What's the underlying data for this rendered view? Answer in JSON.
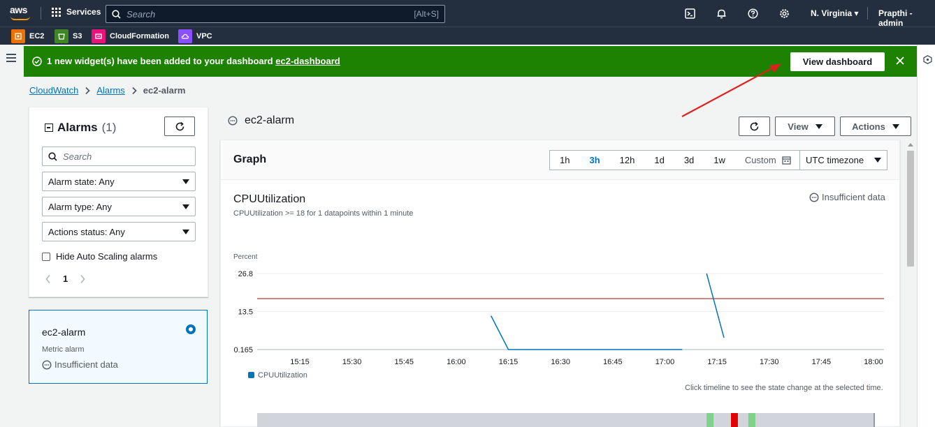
{
  "nav": {
    "logo_text": "aws",
    "services_label": "Services",
    "search_placeholder": "Search",
    "search_shortcut": "[Alt+S]",
    "region": "N. Virginia",
    "user": "Prapthi - admin"
  },
  "favorites": [
    {
      "label": "EC2",
      "color": "#ed7100"
    },
    {
      "label": "S3",
      "color": "#3f8624"
    },
    {
      "label": "CloudFormation",
      "color": "#e7157b"
    },
    {
      "label": "VPC",
      "color": "#8c4fff"
    }
  ],
  "flash": {
    "message": "1 new widget(s) have been added to your dashboard",
    "link": "ec2-dashboard",
    "button": "View dashboard",
    "color": "#1d8102"
  },
  "breadcrumb": {
    "root": "CloudWatch",
    "section": "Alarms",
    "current": "ec2-alarm"
  },
  "alarms_panel": {
    "title": "Alarms",
    "count": "(1)",
    "search_placeholder": "Search",
    "filters": [
      "Alarm state: Any",
      "Alarm type: Any",
      "Actions status: Any"
    ],
    "checkbox_label": "Hide Auto Scaling alarms",
    "page": "1"
  },
  "alarm_card": {
    "name": "ec2-alarm",
    "type": "Metric alarm",
    "state": "Insufficient data"
  },
  "detail": {
    "title": "ec2-alarm",
    "view_label": "View",
    "actions_label": "Actions"
  },
  "graph": {
    "title": "Graph",
    "ranges": [
      "1h",
      "3h",
      "12h",
      "1d",
      "3d",
      "1w"
    ],
    "active_range": "3h",
    "custom_label": "Custom",
    "timezone": "UTC timezone",
    "metric_title": "CPUUtilization",
    "metric_subtitle": "CPUUtilization >= 18 for 1 datapoints within 1 minute",
    "state": "Insufficient data",
    "hint": "Click timeline to see the state change at the selected time."
  },
  "chart_data": {
    "type": "line",
    "title": "CPUUtilization",
    "ylabel": "Percent",
    "yticks": [
      "26.8",
      "13.5",
      "0.165"
    ],
    "ylim": [
      0.165,
      26.8
    ],
    "xticks": [
      "15:15",
      "15:30",
      "15:45",
      "16:00",
      "16:15",
      "16:30",
      "16:45",
      "17:00",
      "17:15",
      "17:30",
      "17:45",
      "18:00"
    ],
    "threshold": 18,
    "threshold_color": "#b23b3b",
    "series": [
      {
        "name": "CPUUtilization",
        "color": "#0073bb",
        "segments": [
          [
            [
              "16:10",
              12
            ],
            [
              "16:15",
              0.165
            ],
            [
              "17:05",
              0.165
            ]
          ],
          [
            [
              "17:12",
              26.8
            ],
            [
              "17:17",
              4.3
            ]
          ]
        ]
      }
    ],
    "legend": "bottom-left",
    "grid": true,
    "timeline_states": [
      {
        "start": "17:12",
        "end": "17:14",
        "color": "#7fd18c"
      },
      {
        "start": "17:19",
        "end": "17:21",
        "color": "#e00000"
      },
      {
        "start": "17:24",
        "end": "17:26",
        "color": "#7fd18c"
      }
    ]
  }
}
